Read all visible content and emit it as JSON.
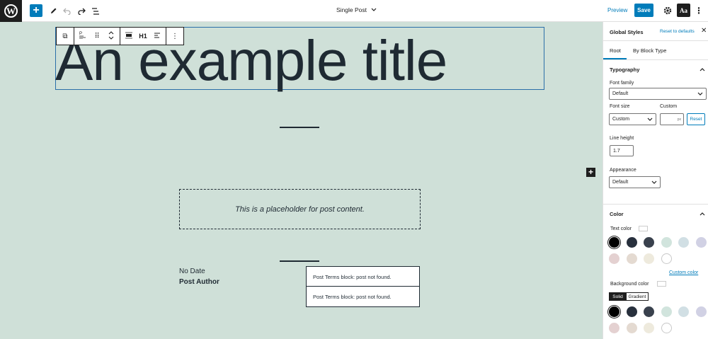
{
  "topbar": {
    "logo_icon": "wordpress-logo",
    "add_icon": "+",
    "template_title": "Single Post",
    "preview_label": "Preview",
    "save_label": "Save",
    "styles_label": "Aa",
    "accent": "#007cba"
  },
  "canvas": {
    "background": "#cfe0d8",
    "title": "An example title",
    "block_toolbar": {
      "heading_level": "H1"
    },
    "placeholder": "This is a placeholder for post content.",
    "post_date": "No Date",
    "post_author": "Post Author",
    "terms": [
      "Post Terms block: post not found.",
      "Post Terms block: post not found."
    ]
  },
  "sidebar": {
    "title": "Global Styles",
    "reset_label": "Reset to defaults",
    "tabs": [
      {
        "label": "Root",
        "active": true
      },
      {
        "label": "By Block Type",
        "active": false
      }
    ],
    "typography": {
      "heading": "Typography",
      "font_family_label": "Font family",
      "font_family_value": "Default",
      "font_size_label": "Font size",
      "custom_label": "Custom",
      "font_size_value": "Custom",
      "custom_unit": "px",
      "reset_button": "Reset",
      "line_height_label": "Line height",
      "line_height_value": "1.7",
      "appearance_label": "Appearance",
      "appearance_value": "Default"
    },
    "color": {
      "heading": "Color",
      "text_color_label": "Text color",
      "custom_color_label": "Custom color",
      "background_color_label": "Background color",
      "seg_solid": "Solid",
      "seg_gradient": "Gradient",
      "palette": [
        "#000000",
        "#28303d",
        "#39414d",
        "#d1e4dd",
        "#d1dfe4",
        "#d1d1e4",
        "#e4d1d1",
        "#e4dad1",
        "#eeeadd",
        "#ffffff"
      ]
    }
  }
}
